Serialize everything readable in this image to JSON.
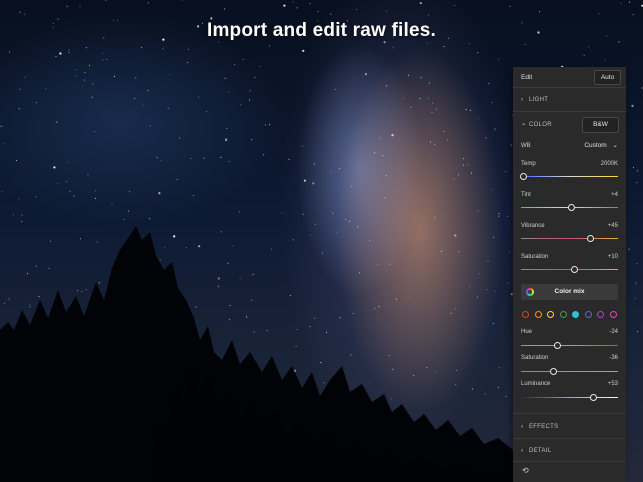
{
  "headline": "Import and edit raw files.",
  "panel": {
    "title": "Edit",
    "auto_label": "Auto",
    "sections": {
      "light": "LIGHT",
      "color": "COLOR",
      "effects": "EFFECTS",
      "detail": "DETAIL"
    },
    "bw_label": "B&W",
    "wb_label": "WB",
    "wb_value": "Custom",
    "sliders": {
      "temp": {
        "label": "Temp",
        "value": "2000K",
        "position": 0.03
      },
      "tint": {
        "label": "Tint",
        "value": "+4",
        "position": 0.52
      },
      "vibrance": {
        "label": "Vibrance",
        "value": "+45",
        "position": 0.72
      },
      "saturation": {
        "label": "Saturation",
        "value": "+10",
        "position": 0.55
      }
    },
    "color_mix_label": "Color mix",
    "swatches": [
      "#e53935",
      "#ff9800",
      "#fdd835",
      "#43a047",
      "#26c6da",
      "#5c6bc0",
      "#ab47bc",
      "#ec40c0"
    ],
    "selected_swatch": 4,
    "mix_sliders": {
      "hue": {
        "label": "Hue",
        "value": "-24",
        "position": 0.38
      },
      "saturation": {
        "label": "Saturation",
        "value": "-36",
        "position": 0.34
      },
      "luminance": {
        "label": "Luminance",
        "value": "+53",
        "position": 0.75
      }
    }
  },
  "icons": {
    "chevron_right": "chevron-right-icon",
    "chevron_down": "chevron-down-icon",
    "color_wheel": "color-wheel-icon",
    "undo": "undo-icon"
  }
}
